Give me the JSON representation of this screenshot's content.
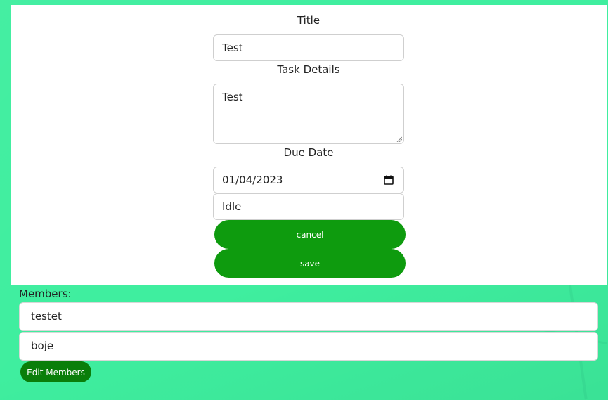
{
  "form": {
    "title_label": "Title",
    "title_value": "Test",
    "details_label": "Task Details",
    "details_value": "Test",
    "due_label": "Due Date",
    "due_value": "01/04/2023",
    "status_value": "Idle",
    "cancel_label": "cancel",
    "save_label": "save"
  },
  "members": {
    "label": "Members:",
    "items": [
      "testet",
      "boje"
    ],
    "edit_label": "Edit Members"
  },
  "colors": {
    "background": "#3fee9f",
    "button_green": "#0e9b0e",
    "edit_button_green": "#0a7e0a"
  },
  "icons": {
    "date_picker": "calendar-icon",
    "textarea_resize": "resize-grip-icon"
  }
}
